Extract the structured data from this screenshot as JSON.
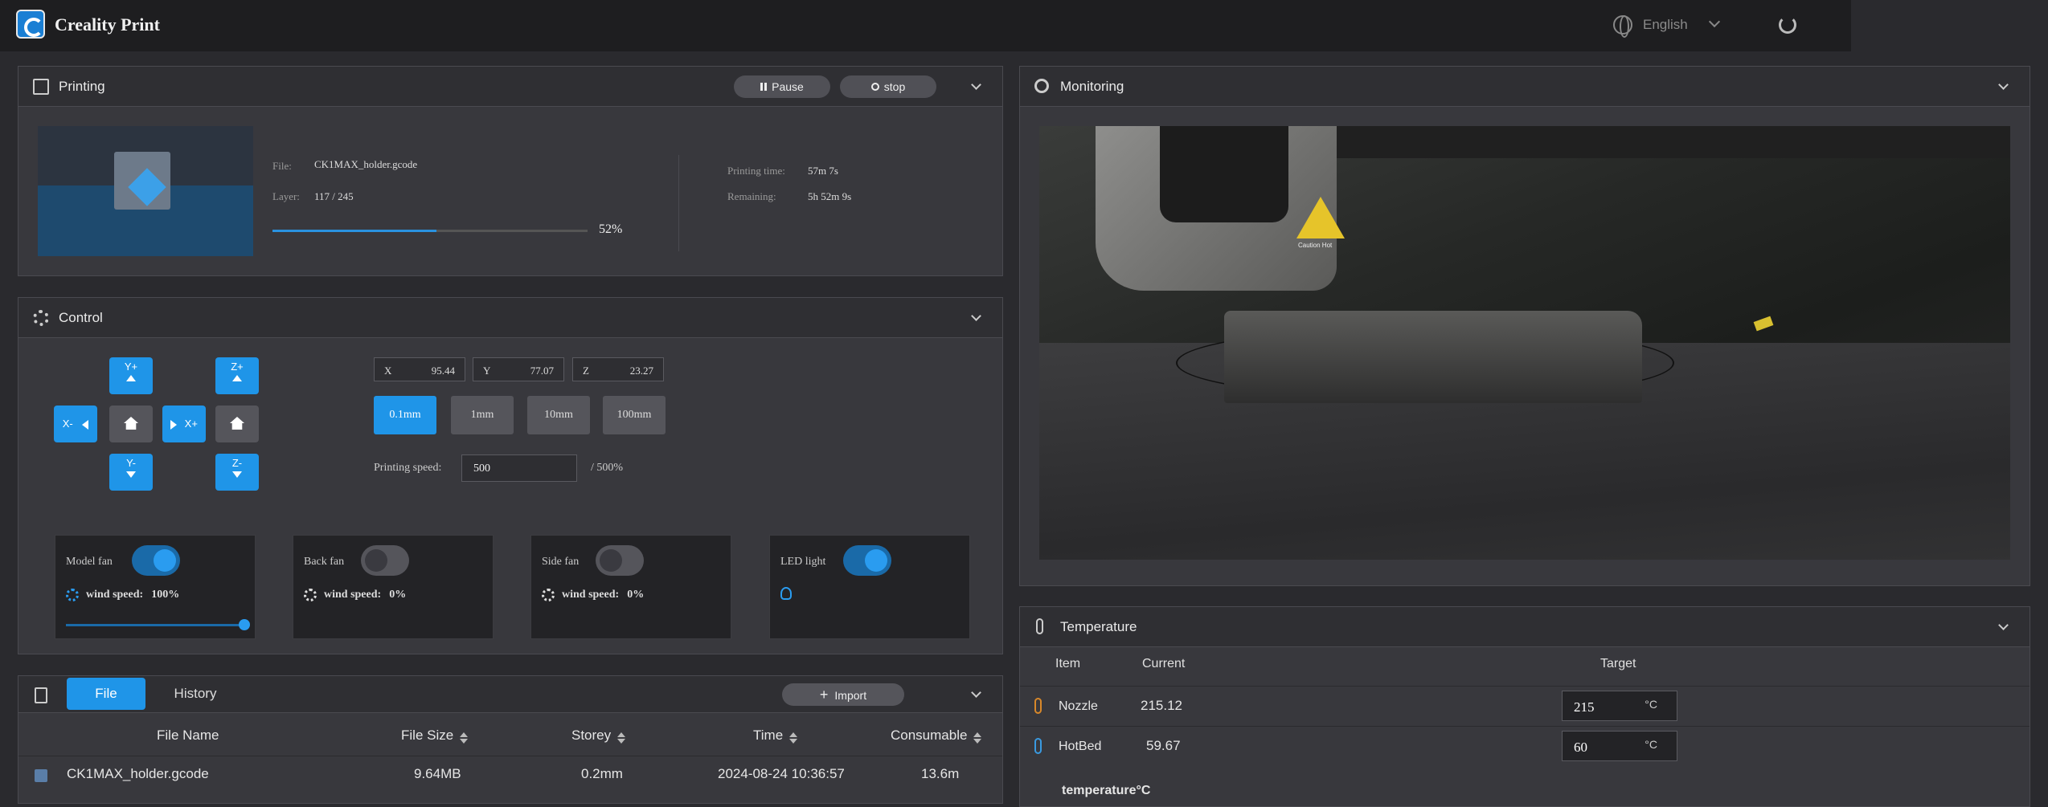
{
  "app": {
    "title": "Creality Print",
    "language": "English"
  },
  "printing": {
    "title": "Printing",
    "pause_label": "Pause",
    "stop_label": "stop",
    "file_label": "File:",
    "file_value": "CK1MAX_holder.gcode",
    "layer_label": "Layer:",
    "layer_value": "117 / 245",
    "progress_text": "52%",
    "progress": 0.52,
    "time_label": "Printing time:",
    "time_value": "57m 7s",
    "remaining_label": "Remaining:",
    "remaining_value": "5h 52m 9s"
  },
  "control": {
    "title": "Control",
    "jog": {
      "y_plus": "Y+",
      "y_minus": "Y-",
      "x_plus": "X+",
      "x_minus": "X-",
      "z_plus": "Z+",
      "z_minus": "Z-"
    },
    "coords": {
      "x_label": "X",
      "x": "95.44",
      "y_label": "Y",
      "y": "77.07",
      "z_label": "Z",
      "z": "23.27"
    },
    "steps": [
      "0.1mm",
      "1mm",
      "10mm",
      "100mm"
    ],
    "speed_label": "Printing speed:",
    "speed_value": "500",
    "speed_max": "/ 500%",
    "fans": [
      {
        "label": "Model fan",
        "on": true,
        "ws_label": "wind speed:",
        "ws_value": "100%",
        "slider": 1.0
      },
      {
        "label": "Back fan",
        "on": false,
        "ws_label": "wind speed:",
        "ws_value": "0%"
      },
      {
        "label": "Side fan",
        "on": false,
        "ws_label": "wind speed:",
        "ws_value": "0%"
      },
      {
        "label": "LED light",
        "on": true
      }
    ]
  },
  "files": {
    "tab_file": "File",
    "tab_history": "History",
    "import_label": "Import",
    "columns": [
      "File Name",
      "File Size",
      "Storey",
      "Time",
      "Consumable"
    ],
    "rows": [
      {
        "name": "CK1MAX_holder.gcode",
        "size": "9.64MB",
        "storey": "0.2mm",
        "time": "2024-08-24 10:36:57",
        "consumable": "13.6m"
      }
    ]
  },
  "monitoring": {
    "title": "Monitoring",
    "caution": "Caution Hot"
  },
  "temperature": {
    "title": "Temperature",
    "columns": [
      "Item",
      "Current",
      "Target"
    ],
    "rows": [
      {
        "name": "Nozzle",
        "current": "215.12",
        "target": "215",
        "unit": "°C"
      },
      {
        "name": "HotBed",
        "current": "59.67",
        "target": "60",
        "unit": "°C"
      }
    ],
    "chart_title": "temperature°C"
  },
  "colors": {
    "accent": "#1f95e8",
    "panel": "#38383d",
    "background": "#2a2a2e"
  }
}
